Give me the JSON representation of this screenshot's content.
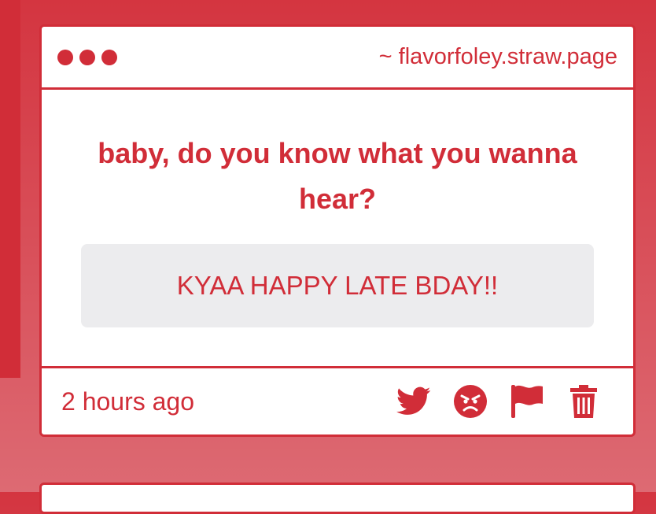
{
  "theme": {
    "accent": "#d12d38",
    "answer_bg": "#ececee"
  },
  "card": {
    "header": {
      "dot_count": 3,
      "site_url": "~ flavorfoley.straw.page"
    },
    "question": "baby, do you know what you wanna hear?",
    "answer": "KYAA HAPPY LATE BDAY!!",
    "timestamp": "2 hours ago",
    "actions": [
      {
        "name": "twitter-icon"
      },
      {
        "name": "angry-face-icon"
      },
      {
        "name": "flag-icon"
      },
      {
        "name": "trash-icon"
      }
    ]
  }
}
